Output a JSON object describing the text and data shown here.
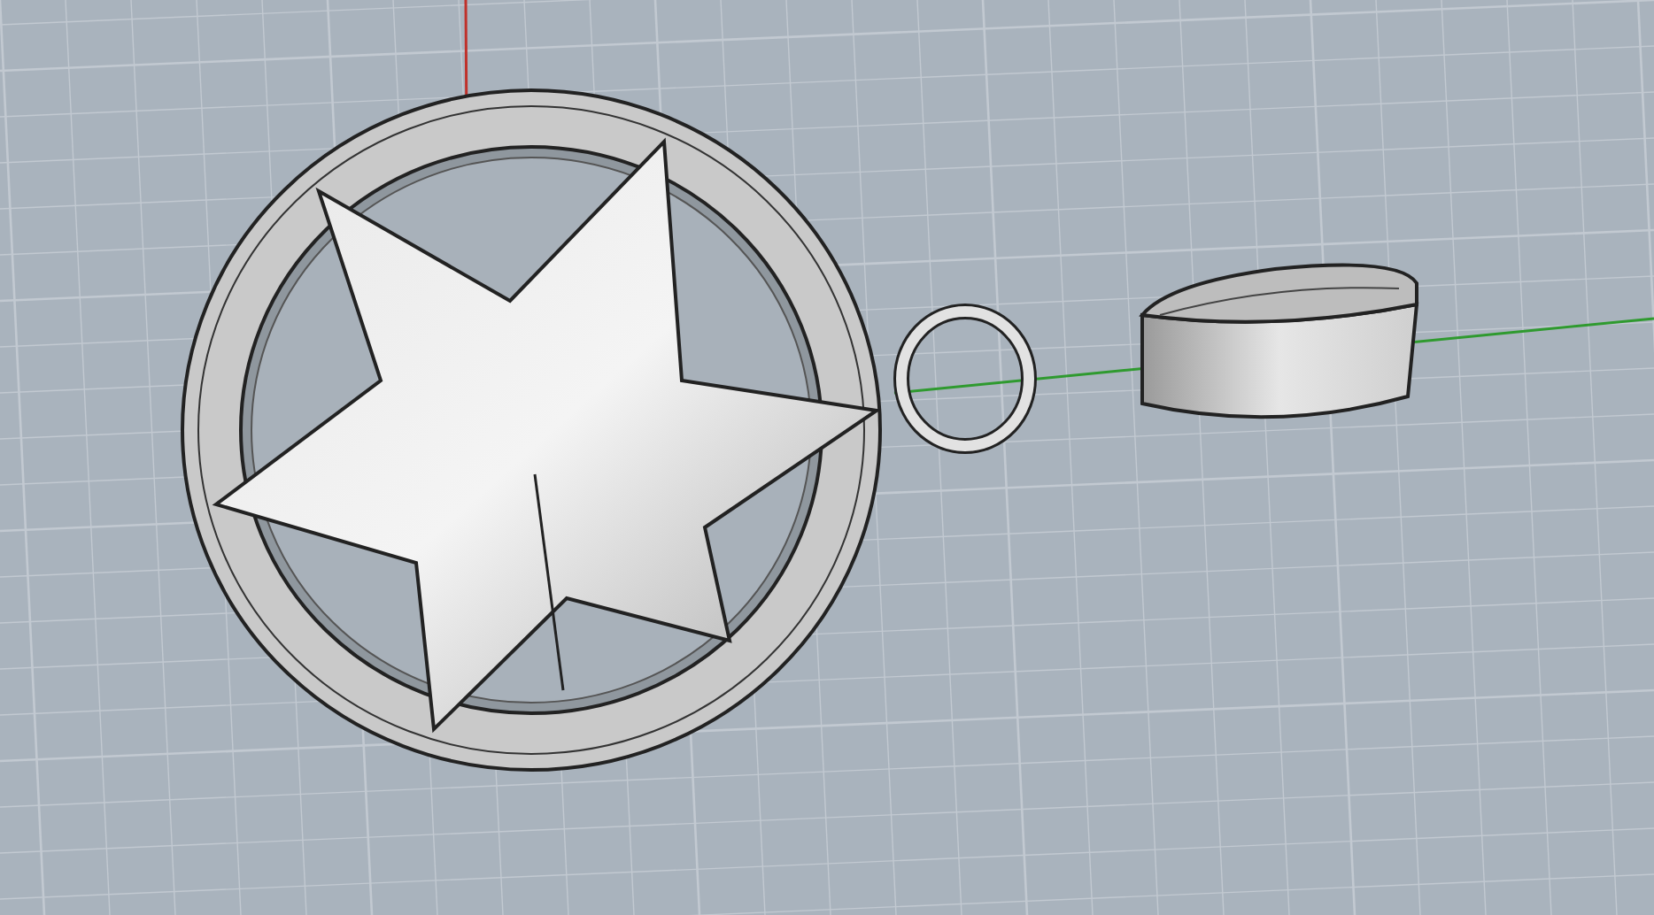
{
  "viewport": {
    "objects": [
      {
        "kind": "star-pendant"
      },
      {
        "kind": "ring"
      }
    ]
  }
}
